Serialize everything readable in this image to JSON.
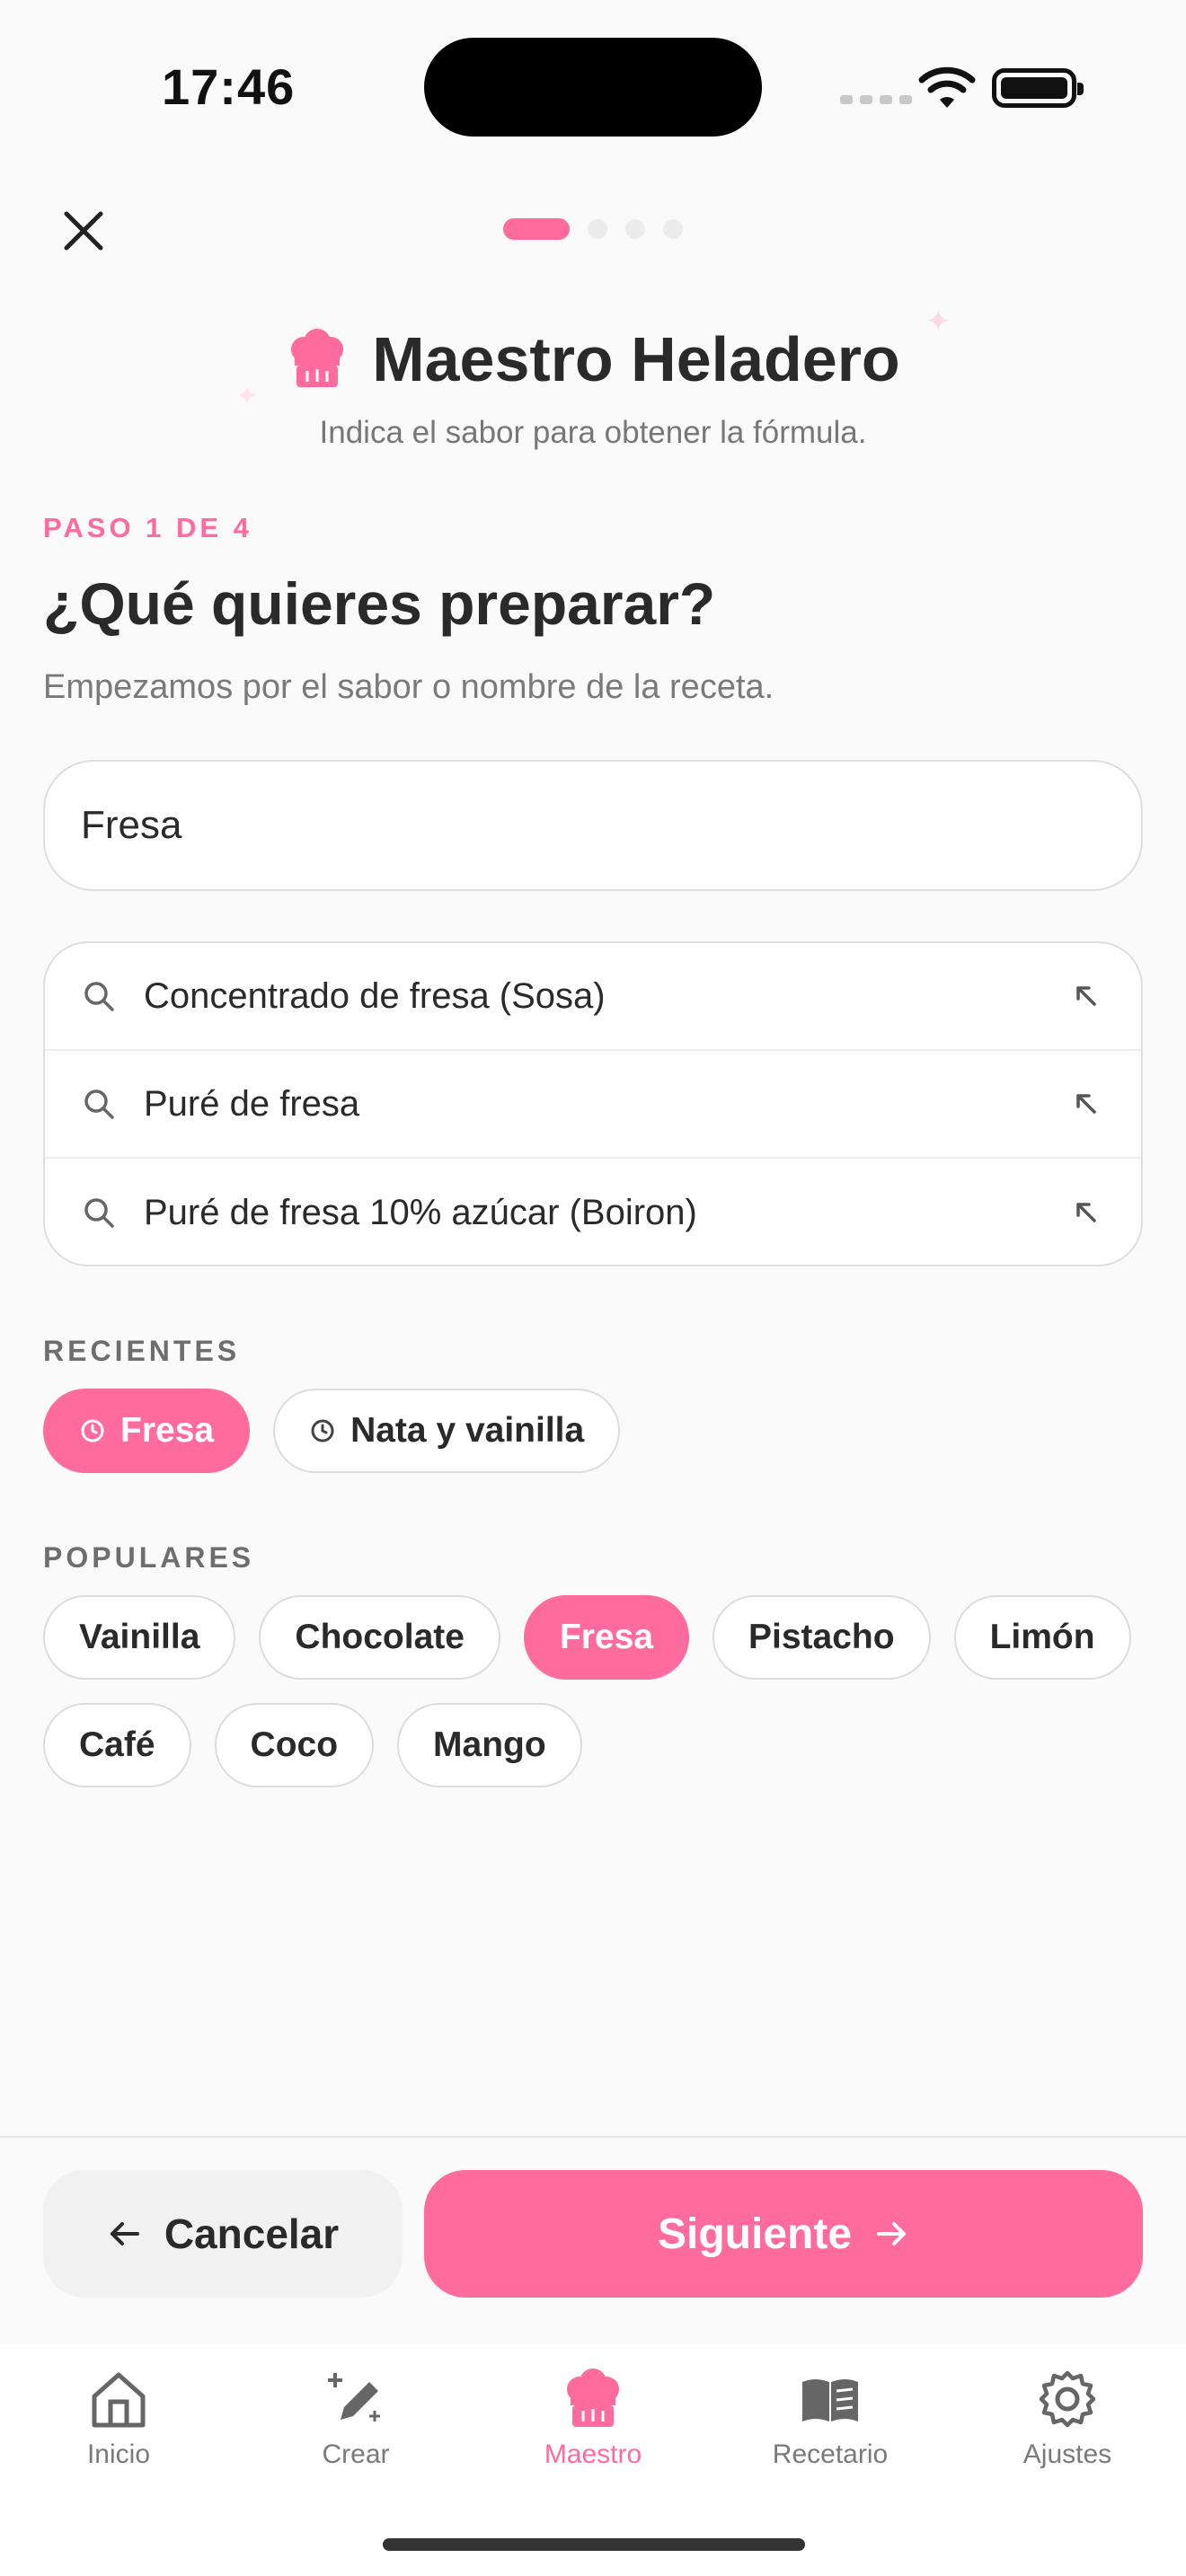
{
  "status_bar": {
    "time": "17:46"
  },
  "progress": {
    "total_steps": 4,
    "current_step": 1
  },
  "header": {
    "title": "Maestro Heladero",
    "subtitle": "Indica el sabor para obtener la fórmula."
  },
  "step": {
    "label": "PASO 1 DE 4",
    "question": "¿Qué quieres preparar?",
    "hint": "Empezamos por el sabor o nombre de la receta."
  },
  "search": {
    "value": "Fresa"
  },
  "suggestions": [
    "Concentrado de fresa (Sosa)",
    "Puré de fresa",
    "Puré de fresa 10% azúcar (Boiron)"
  ],
  "recientes": {
    "label": "RECIENTES",
    "items": [
      "Fresa",
      "Nata y vainilla"
    ]
  },
  "populares": {
    "label": "POPULARES",
    "row1": [
      "Vainilla",
      "Chocolate",
      "Fresa",
      "Pistacho",
      "Limón"
    ],
    "row2": [
      "Café",
      "Coco",
      "Mango"
    ]
  },
  "actions": {
    "cancel": "Cancelar",
    "next": "Siguiente"
  },
  "tabs": {
    "inicio": "Inicio",
    "crear": "Crear",
    "maestro": "Maestro",
    "recetario": "Recetario",
    "ajustes": "Ajustes"
  },
  "colors": {
    "accent": "#ff6b9d",
    "text": "#2a2a2a",
    "muted": "#7a7a7a"
  },
  "icons": {
    "close": "close-icon",
    "chef": "chef-hat-icon",
    "search": "search-icon",
    "arrow": "arrow-up-left-icon",
    "clock": "clock-icon"
  }
}
